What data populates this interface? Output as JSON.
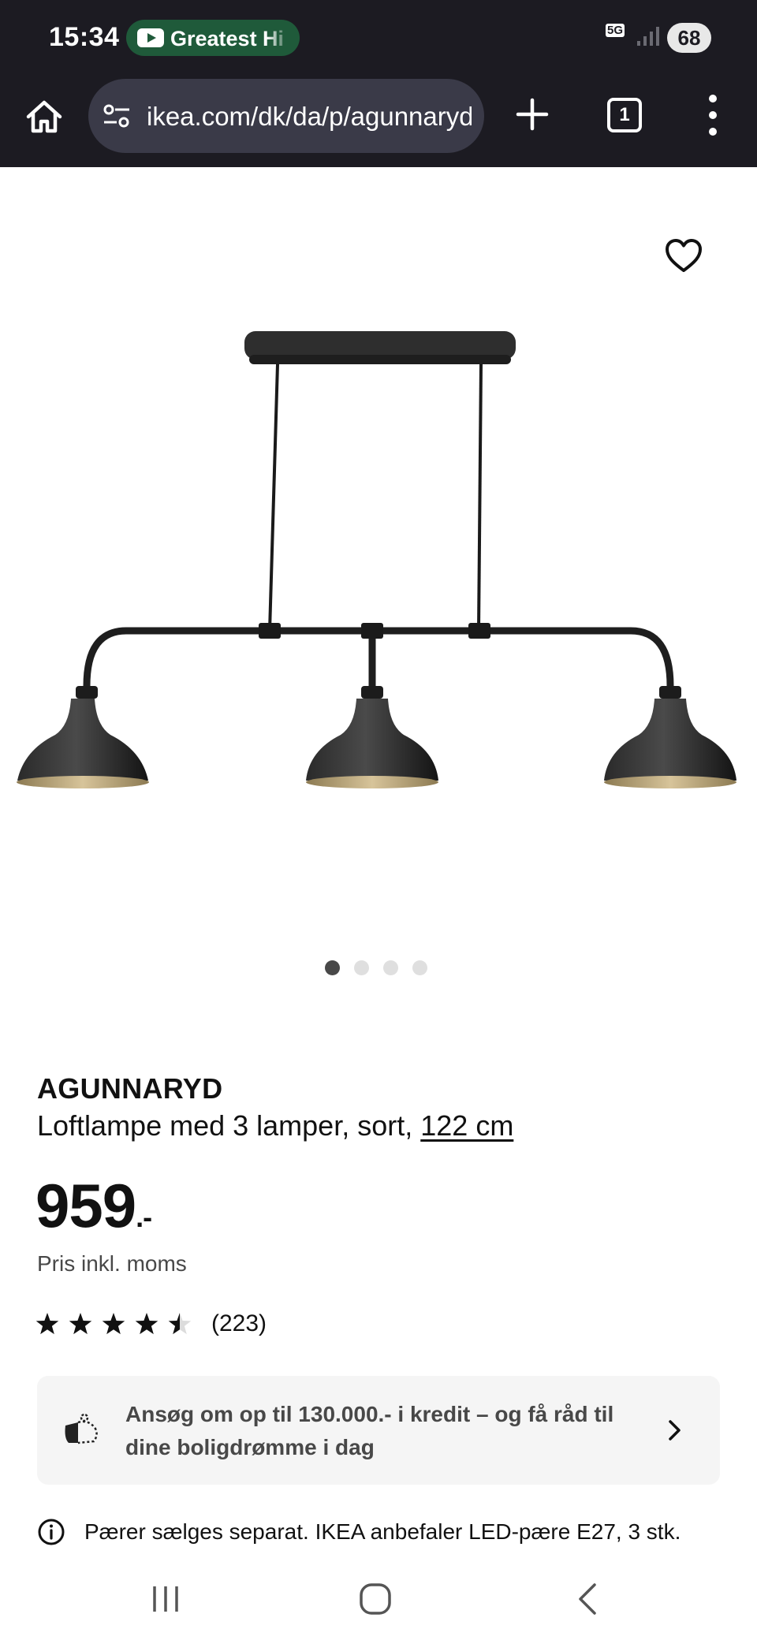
{
  "status_bar": {
    "time": "15:34",
    "media_title": "Greatest Hi",
    "network": "5G",
    "battery": "68"
  },
  "browser": {
    "url": "ikea.com/dk/da/p/agunnaryd",
    "tab_count": "1"
  },
  "gallery": {
    "image_count": 4,
    "active_index": 0
  },
  "product": {
    "brand": "AGUNNARYD",
    "description": "Loftlampe med 3 lamper, sort,",
    "measure": "122 cm",
    "price": "959",
    "price_suffix": ".-",
    "price_note": "Pris inkl. moms",
    "rating_value": 4.5,
    "rating_max": 5,
    "review_count": "(223)"
  },
  "credit_banner": {
    "text": "Ansøg om op til 130.000.- i kredit – og få råd til dine boligdrømme i dag"
  },
  "info": {
    "text": "Pærer sælges separat. IKEA anbefaler LED-pære E27, 3 stk."
  },
  "colors": {
    "status_bg": "#1c1b22",
    "url_bar_bg": "#3a3a48",
    "media_pill": "#1f5a3a",
    "banner_bg": "#f5f5f5"
  },
  "icons": {
    "home": "home-icon",
    "site_settings": "tune-icon",
    "new_tab": "plus-icon",
    "menu": "more-vert-icon",
    "favourite": "heart-icon",
    "credit": "piggy-bank-icon",
    "info": "info-icon",
    "chevron": "chevron-right-icon"
  }
}
